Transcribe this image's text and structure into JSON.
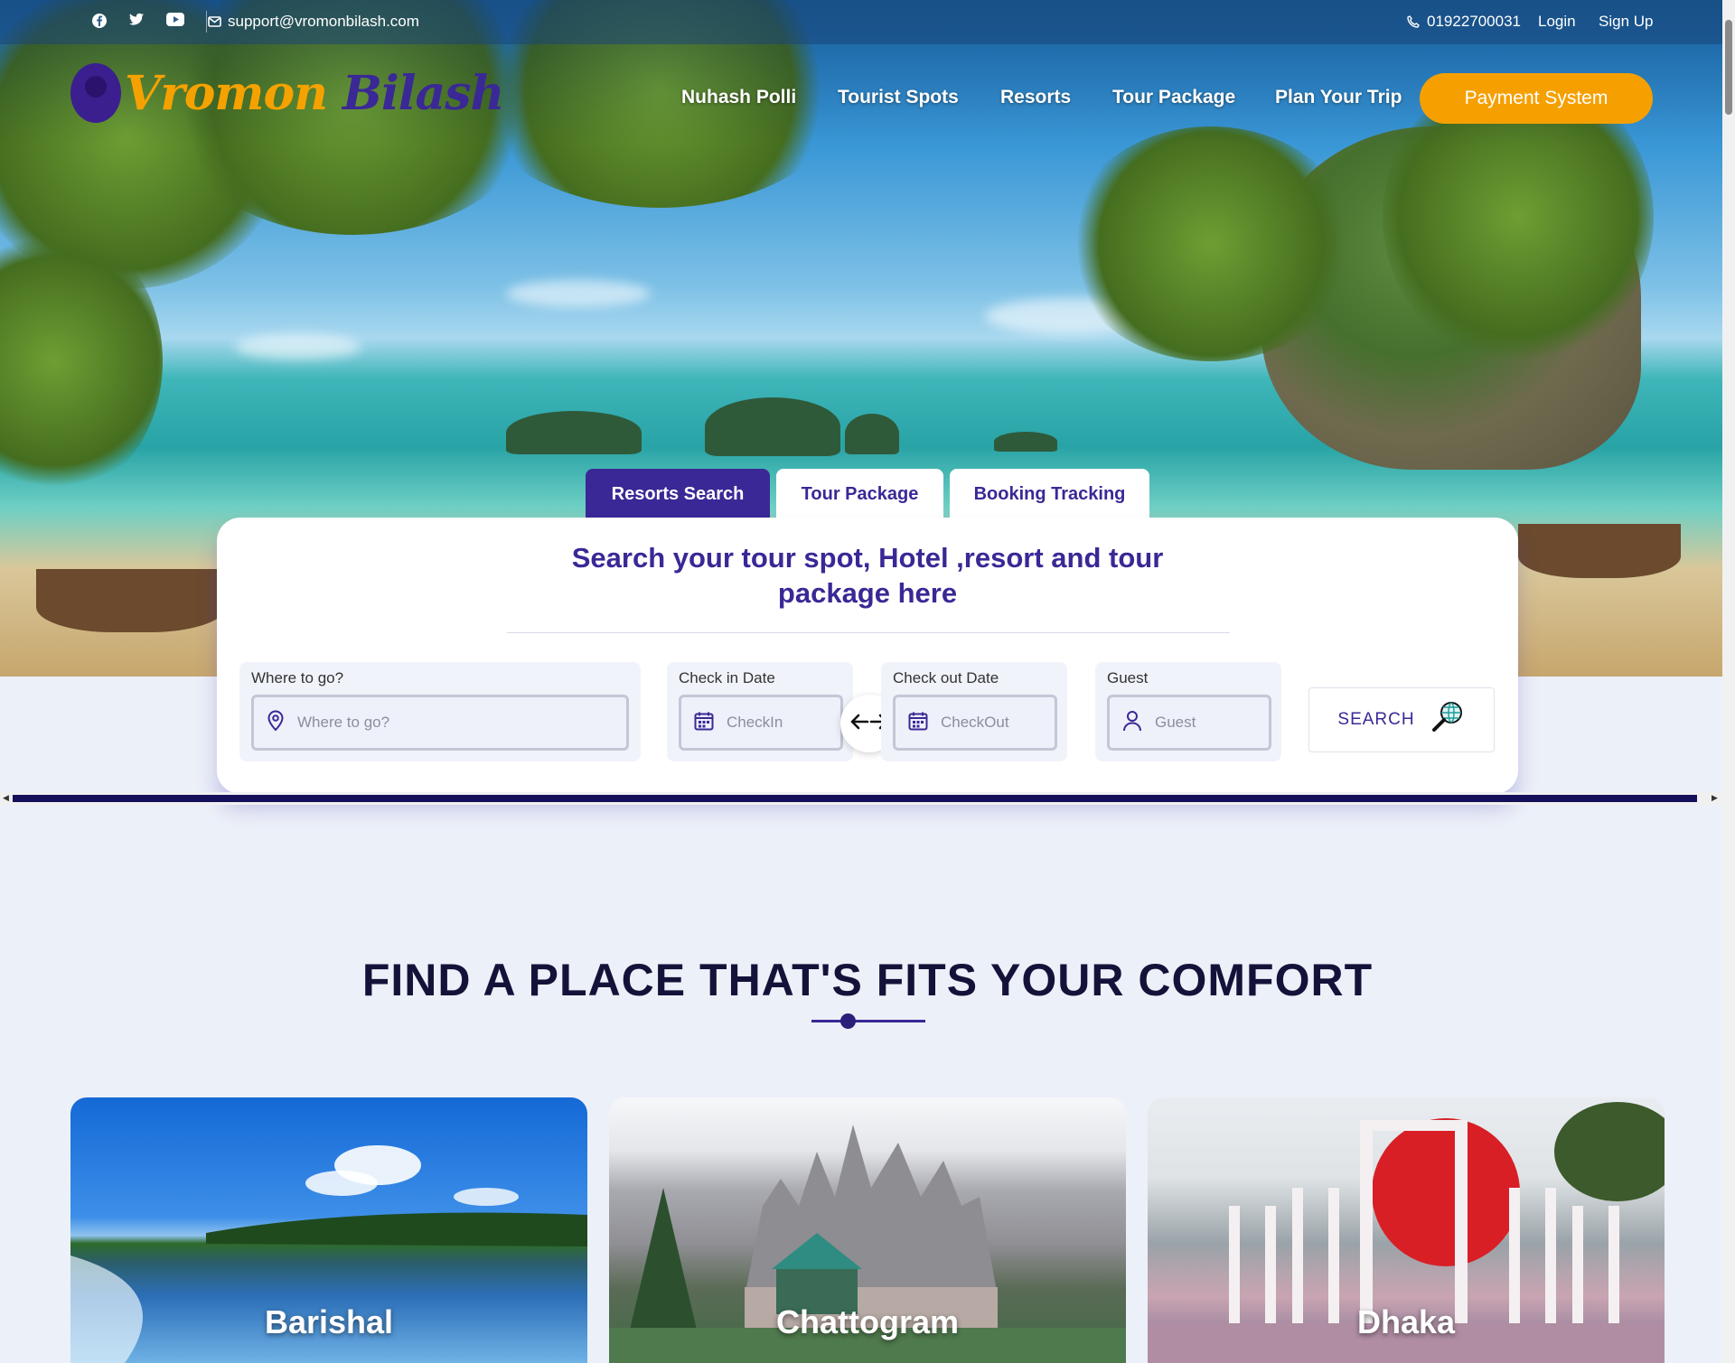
{
  "topbar": {
    "email": "support@vromonbilash.com",
    "phone": "01922700031",
    "login": "Login",
    "signup": "Sign Up",
    "social_icons": [
      "facebook-icon",
      "twitter-icon",
      "youtube-icon"
    ]
  },
  "brand": {
    "name_part1": "Vromon",
    "name_part2": " Bilash"
  },
  "nav": {
    "items": [
      "Nuhash Polli",
      "Tourist Spots",
      "Resorts",
      "Tour Package",
      "Plan Your Trip"
    ],
    "cta": "Payment System"
  },
  "search": {
    "tabs": [
      "Resorts Search",
      "Tour Package",
      "Booking Tracking"
    ],
    "active_tab": "Resorts Search",
    "title": "Search your tour spot, Hotel ,resort and tour package here",
    "fields": {
      "where": {
        "label": "Where to go?",
        "placeholder": "Where to go?"
      },
      "checkin": {
        "label": "Check in Date",
        "placeholder": "CheckIn"
      },
      "checkout": {
        "label": "Check out Date",
        "placeholder": "CheckOut"
      },
      "guest": {
        "label": "Guest",
        "placeholder": "Guest"
      }
    },
    "button": "SEARCH"
  },
  "section": {
    "title": "FIND A PLACE THAT'S FITS YOUR COMFORT",
    "places": [
      "Barishal",
      "Chattogram",
      "Dhaka"
    ]
  },
  "colors": {
    "brand_purple": "#3a2896",
    "accent_orange": "#f5a000",
    "heading_dark": "#15123a",
    "page_bg": "#ecf0f8"
  }
}
